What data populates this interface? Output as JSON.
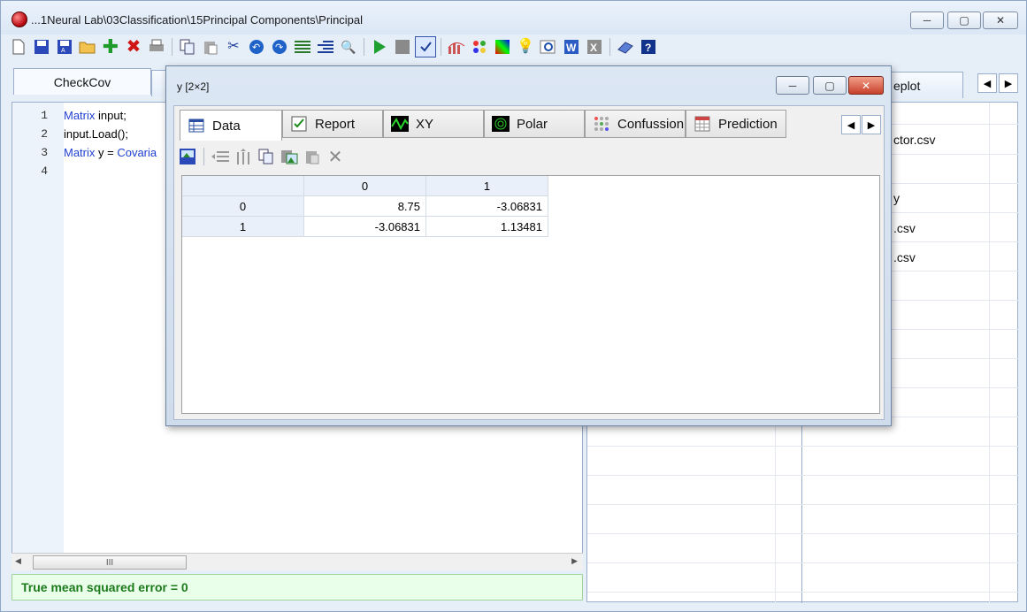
{
  "window": {
    "title": "...1Neural Lab\\03Classification\\15Principal Components\\Principal",
    "minimize": "─",
    "maximize": "▢",
    "close": "✕"
  },
  "toolbar": {
    "icons": [
      "new-file-icon",
      "save-icon",
      "save-as-icon",
      "open-folder-icon",
      "add-icon",
      "delete-icon",
      "print-icon",
      "copy-icon",
      "paste-icon",
      "cut-icon",
      "undo-icon",
      "redo-icon",
      "list-icon",
      "indent-icon",
      "search-icon",
      "run-icon",
      "stop-icon",
      "check-icon",
      "chart-icon",
      "colors-icon",
      "palette-icon",
      "lightbulb-icon",
      "find-icon",
      "word-icon",
      "excel-icon",
      "book-icon",
      "help-icon"
    ]
  },
  "doc_tabs": {
    "active": "CheckCov",
    "right_partial": "eplot"
  },
  "editor": {
    "lines": [
      {
        "no": "1",
        "kw": "Matrix",
        "rest": " input;"
      },
      {
        "no": "2",
        "kw": "",
        "rest": "input.Load();"
      },
      {
        "no": "3",
        "kw": "Matrix",
        "rest": " y = ",
        "kw2": "Covaria"
      },
      {
        "no": "4",
        "kw": "",
        "rest": ""
      }
    ],
    "scroll_thumb": "III",
    "status": "True mean squared error = 0"
  },
  "right_panel": {
    "cells": [
      "ctor.csv",
      "y",
      ".csv",
      ".csv"
    ]
  },
  "dialog": {
    "title": "y [2×2]",
    "tabs": [
      {
        "label": "Data",
        "icon": "table-icon"
      },
      {
        "label": "Report",
        "icon": "checkbox-icon"
      },
      {
        "label": "XY",
        "icon": "wave-icon"
      },
      {
        "label": "Polar",
        "icon": "polar-icon"
      },
      {
        "label": "Confussion",
        "icon": "dots-icon"
      },
      {
        "label": "Prediction",
        "icon": "grid-icon"
      }
    ],
    "table": {
      "columns": [
        "",
        "0",
        "1"
      ],
      "rows": [
        {
          "label": "0",
          "values": [
            "8.75",
            "-3.06831"
          ]
        },
        {
          "label": "1",
          "values": [
            "-3.06831",
            "1.13481"
          ]
        }
      ]
    }
  }
}
